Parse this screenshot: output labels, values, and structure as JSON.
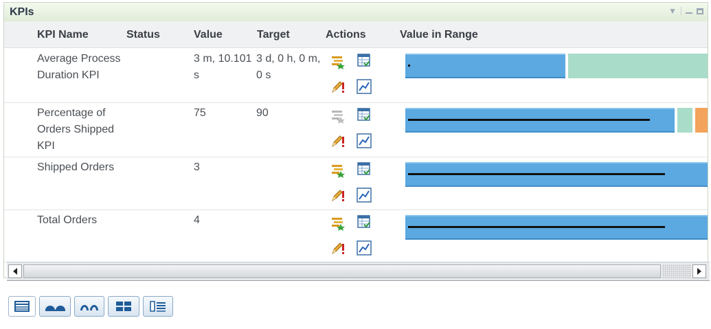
{
  "panel": {
    "title": "KPIs",
    "controls": [
      "dropdown-arrow-icon",
      "minimize-icon",
      "maximize-icon"
    ]
  },
  "table": {
    "columns": [
      "KPI Name",
      "Status",
      "Value",
      "Target",
      "Actions",
      "Value in Range"
    ],
    "rows": [
      {
        "name": "Average Process Duration KPI",
        "status": "",
        "value": "3 m, 10.101 s",
        "target": "3 d, 0 h, 0 m, 0 s",
        "set_target_enabled": true,
        "range": {
          "value_fraction": 0.005,
          "target_fraction": 0.53,
          "bands": [
            "#5ba9e0",
            "#a9dcc9"
          ]
        }
      },
      {
        "name": "Percentage of Orders Shipped KPI",
        "status": "",
        "value": "75",
        "target": "90",
        "set_target_enabled": false,
        "range": {
          "value_fraction": 0.8,
          "target_fraction": 0.89,
          "bands": [
            "#5ba9e0",
            "#a9dcc9",
            "#f3a35b"
          ]
        }
      },
      {
        "name": "Shipped Orders",
        "status": "",
        "value": "3",
        "target": "",
        "set_target_enabled": true,
        "range": {
          "value_fraction": 0.85
        }
      },
      {
        "name": "Total Orders",
        "status": "",
        "value": "4",
        "target": "",
        "set_target_enabled": true,
        "range": {
          "value_fraction": 0.85
        }
      }
    ],
    "actions": [
      "set-target-icon",
      "view-details-icon",
      "edit-alert-icon",
      "view-chart-icon"
    ]
  },
  "view_buttons": [
    "table-view-icon",
    "dial-gauge-view-icon",
    "half-gauge-view-icon",
    "grid-view-icon",
    "list-view-icon"
  ],
  "colors": {
    "bar_blue": "#5ba9e0",
    "bar_green": "#a9dcc9",
    "bar_orange": "#f3a35b",
    "title_bg": "#e9f2e3"
  }
}
